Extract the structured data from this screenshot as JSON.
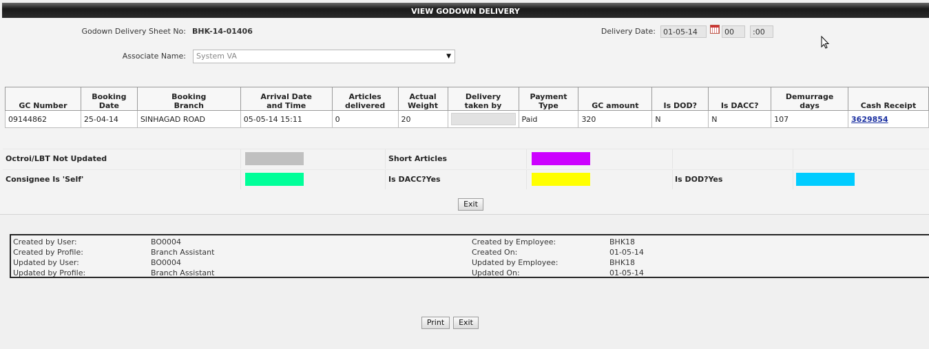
{
  "title": "VIEW GODOWN DELIVERY",
  "header": {
    "sheet_no_label": "Godown Delivery Sheet No:",
    "sheet_no_value": "BHK-14-01406",
    "associate_label": "Associate Name:",
    "associate_value": "System VA",
    "delivery_date_label": "Delivery Date:",
    "delivery_date_value": "01-05-14",
    "hour_value": "00",
    "minute_value": ":00",
    "calendar_icon": "calendar-icon"
  },
  "grid": {
    "columns": [
      {
        "l1": "",
        "l2": "GC Number"
      },
      {
        "l1": "Booking",
        "l2": "Date"
      },
      {
        "l1": "Booking",
        "l2": "Branch"
      },
      {
        "l1": "Arrival Date",
        "l2": "and Time"
      },
      {
        "l1": "Articles",
        "l2": "delivered"
      },
      {
        "l1": "Actual",
        "l2": "Weight"
      },
      {
        "l1": "Delivery",
        "l2": "taken by"
      },
      {
        "l1": "Payment",
        "l2": "Type"
      },
      {
        "l1": "",
        "l2": "GC amount"
      },
      {
        "l1": "",
        "l2": "Is DOD?"
      },
      {
        "l1": "",
        "l2": "Is DACC?"
      },
      {
        "l1": "Demurrage",
        "l2": "days"
      },
      {
        "l1": "",
        "l2": "Cash Receipt"
      }
    ],
    "row": {
      "gc_number": "09144862",
      "booking_date": "25-04-14",
      "booking_branch": "SINHAGAD ROAD",
      "arrival": "05-05-14 15:11",
      "articles": "0",
      "weight": "20",
      "payment_type": "Paid",
      "gc_amount": "320",
      "is_dod": "N",
      "is_dacc": "N",
      "demurrage": "107",
      "cash_receipt": "3629854"
    }
  },
  "legend": {
    "octroi": {
      "label": "Octroi/LBT Not Updated",
      "color": "#c0c0c0"
    },
    "short": {
      "label": "Short Articles",
      "color": "#cc00ff"
    },
    "self": {
      "label": "Consignee Is 'Self'",
      "color": "#00ff99"
    },
    "dacc": {
      "label": "Is DACC?Yes",
      "color": "#ffff00"
    },
    "dod": {
      "label": "Is DOD?Yes",
      "color": "#00ccff"
    }
  },
  "buttons": {
    "exit_top": "Exit",
    "print": "Print",
    "exit_bottom": "Exit"
  },
  "audit": {
    "created_by_user_label": "Created by User:",
    "created_by_user": "BO0004",
    "created_by_profile_label": "Created by Profile:",
    "created_by_profile": "Branch Assistant",
    "updated_by_user_label": "Updated by User:",
    "updated_by_user": "BO0004",
    "updated_by_profile_label": "Updated by Profile:",
    "updated_by_profile": "Branch Assistant",
    "created_by_employee_label": "Created by Employee:",
    "created_by_employee": "BHK18",
    "created_on_label": "Created On:",
    "created_on": "01-05-14",
    "updated_by_employee_label": "Updated by Employee:",
    "updated_by_employee": "BHK18",
    "updated_on_label": "Updated On:",
    "updated_on": "01-05-14"
  }
}
